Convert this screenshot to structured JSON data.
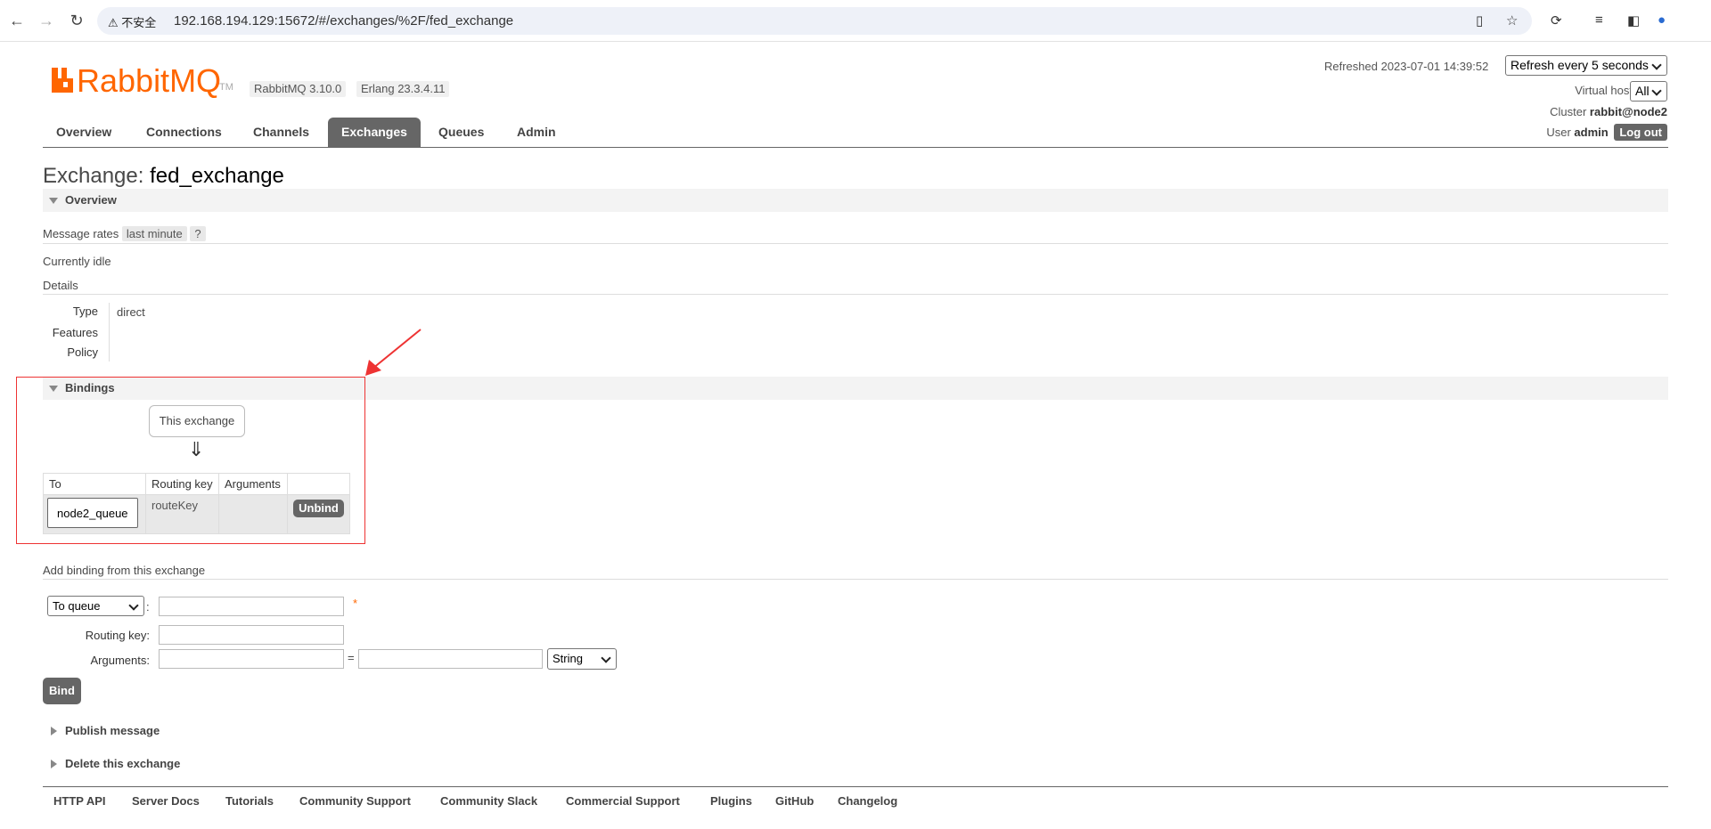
{
  "browser": {
    "security_label": "不安全",
    "url": "192.168.194.129:15672/#/exchanges/%2F/fed_exchange"
  },
  "brand": {
    "logo_text": "RabbitMQ",
    "tm": "TM",
    "rabbitmq_version": "RabbitMQ 3.10.0",
    "erlang_version": "Erlang 23.3.4.11",
    "accent_color": "#ff6600"
  },
  "header": {
    "refreshed_label": "Refreshed 2023-07-01 14:39:52",
    "refresh_select": "Refresh every 5 seconds",
    "vhost_label": "Virtual host",
    "vhost_value": "All",
    "cluster_label": "Cluster",
    "cluster_value": "rabbit@node2",
    "user_label": "User",
    "user_value": "admin",
    "logout_label": "Log out"
  },
  "tabs": [
    {
      "label": "Overview",
      "active": false
    },
    {
      "label": "Connections",
      "active": false
    },
    {
      "label": "Channels",
      "active": false
    },
    {
      "label": "Exchanges",
      "active": true
    },
    {
      "label": "Queues",
      "active": false
    },
    {
      "label": "Admin",
      "active": false
    }
  ],
  "page": {
    "title_prefix": "Exchange:",
    "title_name": "fed_exchange"
  },
  "overview": {
    "section_title": "Overview",
    "message_rates_label": "Message rates",
    "rates_range": "last minute",
    "help": "?",
    "idle_text": "Currently idle",
    "details_title": "Details",
    "type_label": "Type",
    "type_value": "direct",
    "features_label": "Features",
    "policy_label": "Policy"
  },
  "bindings": {
    "section_title": "Bindings",
    "this_exchange": "This exchange",
    "arrow": "⇓",
    "columns": [
      "To",
      "Routing key",
      "Arguments",
      ""
    ],
    "rows": [
      {
        "to": "node2_queue",
        "routing_key": "routeKey",
        "arguments": "",
        "action": "Unbind"
      }
    ]
  },
  "add_binding": {
    "title": "Add binding from this exchange",
    "destination_select": "To queue",
    "required_mark": "*",
    "routing_key_label": "Routing key:",
    "arguments_label": "Arguments:",
    "equals": "=",
    "arg_type_select": "String",
    "bind_button": "Bind"
  },
  "collapsed_sections": {
    "publish": "Publish message",
    "delete": "Delete this exchange"
  },
  "footer_links": [
    "HTTP API",
    "Server Docs",
    "Tutorials",
    "Community Support",
    "Community Slack",
    "Commercial Support",
    "Plugins",
    "GitHub",
    "Changelog"
  ]
}
